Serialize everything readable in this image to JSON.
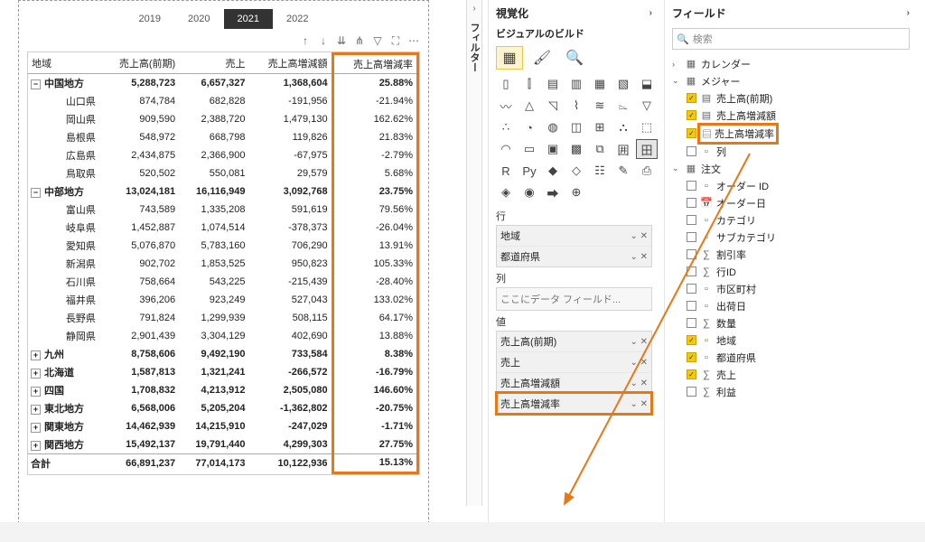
{
  "years": [
    "2019",
    "2020",
    "2021",
    "2022"
  ],
  "activeYear": "2021",
  "toolbarIcons": [
    "drill-up-icon",
    "drill-down-icon",
    "expand-icon",
    "fork-icon",
    "filter-icon",
    "focus-icon",
    "more-icon"
  ],
  "matrix": {
    "headers": [
      "地域",
      "売上高(前期)",
      "売上",
      "売上高増減額",
      "売上高増減率"
    ],
    "rows": [
      {
        "t": "region",
        "exp": "−",
        "cells": [
          "中国地方",
          "5,288,723",
          "6,657,327",
          "1,368,604",
          "25.88%"
        ]
      },
      {
        "t": "pref",
        "cells": [
          "山口県",
          "874,784",
          "682,828",
          "-191,956",
          "-21.94%"
        ]
      },
      {
        "t": "pref",
        "cells": [
          "岡山県",
          "909,590",
          "2,388,720",
          "1,479,130",
          "162.62%"
        ]
      },
      {
        "t": "pref",
        "cells": [
          "島根県",
          "548,972",
          "668,798",
          "119,826",
          "21.83%"
        ]
      },
      {
        "t": "pref",
        "cells": [
          "広島県",
          "2,434,875",
          "2,366,900",
          "-67,975",
          "-2.79%"
        ]
      },
      {
        "t": "pref",
        "cells": [
          "鳥取県",
          "520,502",
          "550,081",
          "29,579",
          "5.68%"
        ]
      },
      {
        "t": "region",
        "exp": "−",
        "cells": [
          "中部地方",
          "13,024,181",
          "16,116,949",
          "3,092,768",
          "23.75%"
        ]
      },
      {
        "t": "pref",
        "cells": [
          "富山県",
          "743,589",
          "1,335,208",
          "591,619",
          "79.56%"
        ]
      },
      {
        "t": "pref",
        "cells": [
          "岐阜県",
          "1,452,887",
          "1,074,514",
          "-378,373",
          "-26.04%"
        ]
      },
      {
        "t": "pref",
        "cells": [
          "愛知県",
          "5,076,870",
          "5,783,160",
          "706,290",
          "13.91%"
        ]
      },
      {
        "t": "pref",
        "cells": [
          "新潟県",
          "902,702",
          "1,853,525",
          "950,823",
          "105.33%"
        ]
      },
      {
        "t": "pref",
        "cells": [
          "石川県",
          "758,664",
          "543,225",
          "-215,439",
          "-28.40%"
        ]
      },
      {
        "t": "pref",
        "cells": [
          "福井県",
          "396,206",
          "923,249",
          "527,043",
          "133.02%"
        ]
      },
      {
        "t": "pref",
        "cells": [
          "長野県",
          "791,824",
          "1,299,939",
          "508,115",
          "64.17%"
        ]
      },
      {
        "t": "pref",
        "cells": [
          "静岡県",
          "2,901,439",
          "3,304,129",
          "402,690",
          "13.88%"
        ]
      },
      {
        "t": "region",
        "exp": "+",
        "cells": [
          "九州",
          "8,758,606",
          "9,492,190",
          "733,584",
          "8.38%"
        ]
      },
      {
        "t": "region",
        "exp": "+",
        "cells": [
          "北海道",
          "1,587,813",
          "1,321,241",
          "-266,572",
          "-16.79%"
        ]
      },
      {
        "t": "region",
        "exp": "+",
        "cells": [
          "四国",
          "1,708,832",
          "4,213,912",
          "2,505,080",
          "146.60%"
        ]
      },
      {
        "t": "region",
        "exp": "+",
        "cells": [
          "東北地方",
          "6,568,006",
          "5,205,204",
          "-1,362,802",
          "-20.75%"
        ]
      },
      {
        "t": "region",
        "exp": "+",
        "cells": [
          "関東地方",
          "14,462,939",
          "14,215,910",
          "-247,029",
          "-1.71%"
        ]
      },
      {
        "t": "region",
        "exp": "+",
        "cells": [
          "関西地方",
          "15,492,137",
          "19,791,440",
          "4,299,303",
          "27.75%"
        ]
      },
      {
        "t": "total",
        "cells": [
          "合計",
          "66,891,237",
          "77,014,173",
          "10,122,936",
          "15.13%"
        ]
      }
    ]
  },
  "filtersTab": "フィルター",
  "vizPane": {
    "title": "視覚化",
    "sub": "ビジュアルのビルド",
    "gallery": [
      "column-stacked",
      "column-clustered",
      "bar-stacked",
      "bar-clustered",
      "bar-100",
      "column-100",
      "column-line",
      "line",
      "area",
      "area-stacked",
      "line-col",
      "ribbon",
      "waterfall",
      "funnel",
      "scatter",
      "pie",
      "donut",
      "treemap",
      "map",
      "filled-map",
      "azure-map",
      "gauge",
      "card",
      "multi-card",
      "kpi",
      "slicer",
      "table",
      "matrix",
      "r",
      "py",
      "key-influencer",
      "decomp",
      "qa",
      "narrative",
      "paginated",
      "arcgis",
      "powerapps",
      "automate",
      "get-more",
      "blank1",
      "blank2",
      "blank3"
    ],
    "galleryGlyphs": [
      "▯",
      "⫿",
      "▤",
      "▥",
      "▦",
      "▧",
      "⬓",
      "〰",
      "△",
      "◹",
      "⌇",
      "≋",
      "⌳",
      "▽",
      "∴",
      "◔",
      "◍",
      "◫",
      "⊞",
      "⛬",
      "⬚",
      "◠",
      "▭",
      "▣",
      "▩",
      "⧉",
      "囲",
      "田",
      "R",
      "Py",
      "◆",
      "◇",
      "☷",
      "✎",
      "⎙",
      "◈",
      "◉",
      "⮕",
      "⊕",
      "",
      "",
      ""
    ],
    "rows_label": "行",
    "rows_items": [
      "地域",
      "都道府県"
    ],
    "cols_label": "列",
    "cols_placeholder": "ここにデータ フィールド...",
    "values_label": "値",
    "values_items": [
      "売上高(前期)",
      "売上",
      "売上高増減額",
      "売上高増減率"
    ]
  },
  "fieldsPane": {
    "title": "フィールド",
    "searchPlaceholder": "検索",
    "tables": [
      {
        "name": "カレンダー",
        "open": false,
        "icon": "table"
      },
      {
        "name": "メジャー",
        "open": true,
        "icon": "table",
        "fields": [
          {
            "name": "売上高(前期)",
            "checked": true,
            "icon": "measure"
          },
          {
            "name": "売上高増減額",
            "checked": true,
            "icon": "measure"
          },
          {
            "name": "売上高増減率",
            "checked": true,
            "icon": "measure",
            "highlight": true
          },
          {
            "name": "列",
            "checked": false,
            "icon": "column"
          }
        ]
      },
      {
        "name": "注文",
        "open": true,
        "icon": "table",
        "fields": [
          {
            "name": "オーダー ID",
            "checked": false,
            "icon": "column"
          },
          {
            "name": "オーダー日",
            "checked": false,
            "icon": "date"
          },
          {
            "name": "カテゴリ",
            "checked": false,
            "icon": "column"
          },
          {
            "name": "サブカテゴリ",
            "checked": false,
            "icon": "column"
          },
          {
            "name": "割引率",
            "checked": false,
            "icon": "sigma"
          },
          {
            "name": "行ID",
            "checked": false,
            "icon": "sigma"
          },
          {
            "name": "市区町村",
            "checked": false,
            "icon": "column"
          },
          {
            "name": "出荷日",
            "checked": false,
            "icon": "column"
          },
          {
            "name": "数量",
            "checked": false,
            "icon": "sigma"
          },
          {
            "name": "地域",
            "checked": true,
            "icon": "column"
          },
          {
            "name": "都道府県",
            "checked": true,
            "icon": "column"
          },
          {
            "name": "売上",
            "checked": true,
            "icon": "sigma"
          },
          {
            "name": "利益",
            "checked": false,
            "icon": "sigma"
          }
        ]
      }
    ]
  }
}
